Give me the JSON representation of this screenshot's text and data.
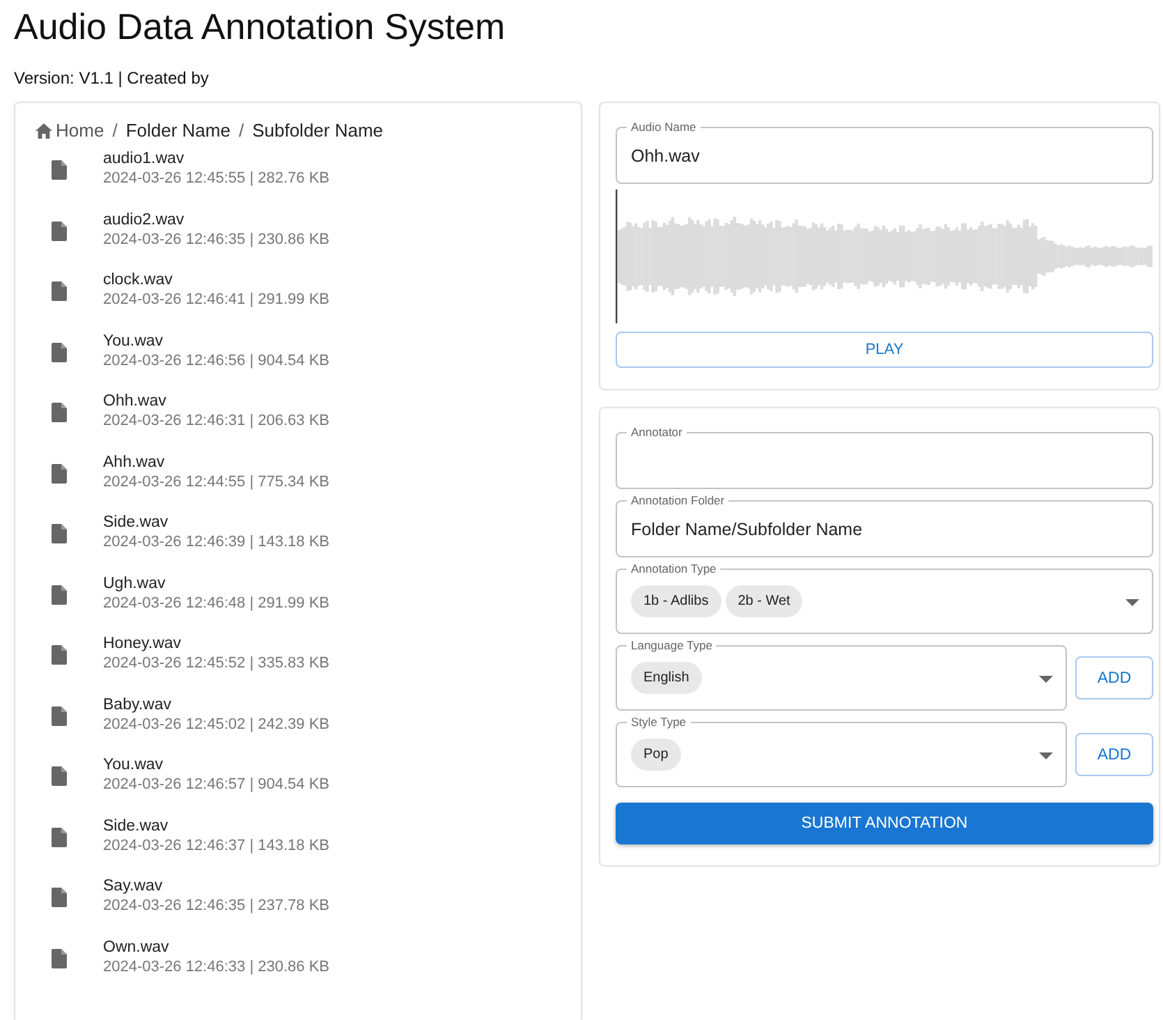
{
  "header": {
    "title": "Audio Data Annotation System",
    "subtitle": "Version: V1.1 | Created by"
  },
  "breadcrumb_separator": "/",
  "breadcrumb": [
    {
      "label": "Home",
      "kind": "home"
    },
    {
      "label": "Folder Name",
      "kind": "folder"
    },
    {
      "label": "Subfolder Name",
      "kind": "folder"
    }
  ],
  "files": [
    {
      "name": "audio1.wav",
      "meta": "2024-03-26 12:45:55 | 282.76 KB"
    },
    {
      "name": "audio2.wav",
      "meta": "2024-03-26 12:46:35 | 230.86 KB"
    },
    {
      "name": "clock.wav",
      "meta": "2024-03-26 12:46:41 | 291.99 KB"
    },
    {
      "name": "You.wav",
      "meta": "2024-03-26 12:46:56 | 904.54 KB"
    },
    {
      "name": "Ohh.wav",
      "meta": "2024-03-26 12:46:31 | 206.63 KB"
    },
    {
      "name": "Ahh.wav",
      "meta": "2024-03-26 12:44:55 | 775.34 KB"
    },
    {
      "name": "Side.wav",
      "meta": "2024-03-26 12:46:39 | 143.18 KB"
    },
    {
      "name": "Ugh.wav",
      "meta": "2024-03-26 12:46:48 | 291.99 KB"
    },
    {
      "name": "Honey.wav",
      "meta": "2024-03-26 12:45:52 | 335.83 KB"
    },
    {
      "name": "Baby.wav",
      "meta": "2024-03-26 12:45:02 | 242.39 KB"
    },
    {
      "name": "You.wav",
      "meta": "2024-03-26 12:46:57 | 904.54 KB"
    },
    {
      "name": "Side.wav",
      "meta": "2024-03-26 12:46:37 | 143.18 KB"
    },
    {
      "name": "Say.wav",
      "meta": "2024-03-26 12:46:35 | 237.78 KB"
    },
    {
      "name": "Own.wav",
      "meta": "2024-03-26 12:46:33 | 230.86 KB"
    }
  ],
  "player": {
    "audio_name": {
      "label": "Audio Name",
      "value": "Ohh.wav"
    },
    "play_button": "PLAY"
  },
  "form": {
    "fields": [
      {
        "kind": "text",
        "label": "Annotator"
      },
      {
        "kind": "text",
        "label": "Annotation Folder",
        "value": "Folder Name/Subfolder Name"
      },
      {
        "kind": "select",
        "label": "Annotation Type",
        "chips": [
          "1b - Adlibs",
          "2b - Wet"
        ]
      },
      {
        "kind": "select",
        "label": "Language Type",
        "chips": [
          "English"
        ],
        "add_button": "ADD"
      },
      {
        "kind": "select",
        "label": "Style Type",
        "chips": [
          "Pop"
        ],
        "add_button": "ADD"
      }
    ],
    "submit_button": "SUBMIT ANNOTATION"
  }
}
